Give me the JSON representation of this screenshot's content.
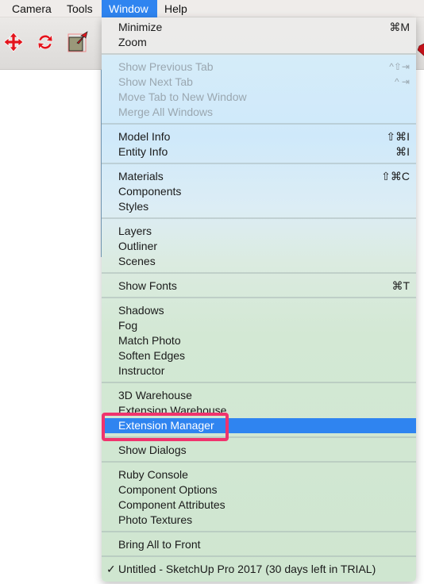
{
  "menubar": {
    "items": [
      {
        "label": "Camera"
      },
      {
        "label": "Tools"
      },
      {
        "label": "Window",
        "active": true
      },
      {
        "label": "Help"
      }
    ]
  },
  "toolbar": {
    "tools": [
      {
        "icon": "move-icon"
      },
      {
        "icon": "rotate-icon"
      },
      {
        "icon": "scale-icon"
      }
    ],
    "partial_icon": "ruby-icon"
  },
  "window_menu": {
    "groups": [
      [
        {
          "label": "Minimize",
          "shortcut": "⌘M"
        },
        {
          "label": "Zoom",
          "shortcut": ""
        }
      ],
      [
        {
          "label": "Show Previous Tab",
          "shortcut": "^⇧⇥",
          "disabled": true
        },
        {
          "label": "Show Next Tab",
          "shortcut": "^ ⇥",
          "disabled": true
        },
        {
          "label": "Move Tab to New Window",
          "shortcut": "",
          "disabled": true
        },
        {
          "label": "Merge All Windows",
          "shortcut": "",
          "disabled": true
        }
      ],
      [
        {
          "label": "Model Info",
          "shortcut": "⇧⌘I"
        },
        {
          "label": "Entity Info",
          "shortcut": "⌘I"
        }
      ],
      [
        {
          "label": "Materials",
          "shortcut": "⇧⌘C"
        },
        {
          "label": "Components",
          "shortcut": ""
        },
        {
          "label": "Styles",
          "shortcut": ""
        }
      ],
      [
        {
          "label": "Layers",
          "shortcut": ""
        },
        {
          "label": "Outliner",
          "shortcut": ""
        },
        {
          "label": "Scenes",
          "shortcut": ""
        }
      ],
      [
        {
          "label": "Show Fonts",
          "shortcut": "⌘T"
        }
      ],
      [
        {
          "label": "Shadows",
          "shortcut": ""
        },
        {
          "label": "Fog",
          "shortcut": ""
        },
        {
          "label": "Match Photo",
          "shortcut": ""
        },
        {
          "label": "Soften Edges",
          "shortcut": ""
        },
        {
          "label": "Instructor",
          "shortcut": ""
        }
      ],
      [
        {
          "label": "3D Warehouse",
          "shortcut": ""
        },
        {
          "label": "Extension Warehouse",
          "shortcut": ""
        },
        {
          "label": "Extension Manager",
          "shortcut": "",
          "selected": true
        }
      ],
      [
        {
          "label": "Show Dialogs",
          "shortcut": ""
        }
      ],
      [
        {
          "label": "Ruby Console",
          "shortcut": ""
        },
        {
          "label": "Component Options",
          "shortcut": ""
        },
        {
          "label": "Component Attributes",
          "shortcut": ""
        },
        {
          "label": "Photo Textures",
          "shortcut": ""
        }
      ],
      [
        {
          "label": "Bring All to Front",
          "shortcut": ""
        }
      ],
      [
        {
          "label": "Untitled - SketchUp Pro 2017 (30 days left in TRIAL)",
          "shortcut": "",
          "checked": true,
          "check_glyph": "✓"
        }
      ]
    ]
  },
  "annotation": {
    "target": "Extension Manager",
    "color": "#f0336d"
  },
  "colors": {
    "accent": "#2f84f0",
    "highlight_box": "#f0336d"
  }
}
